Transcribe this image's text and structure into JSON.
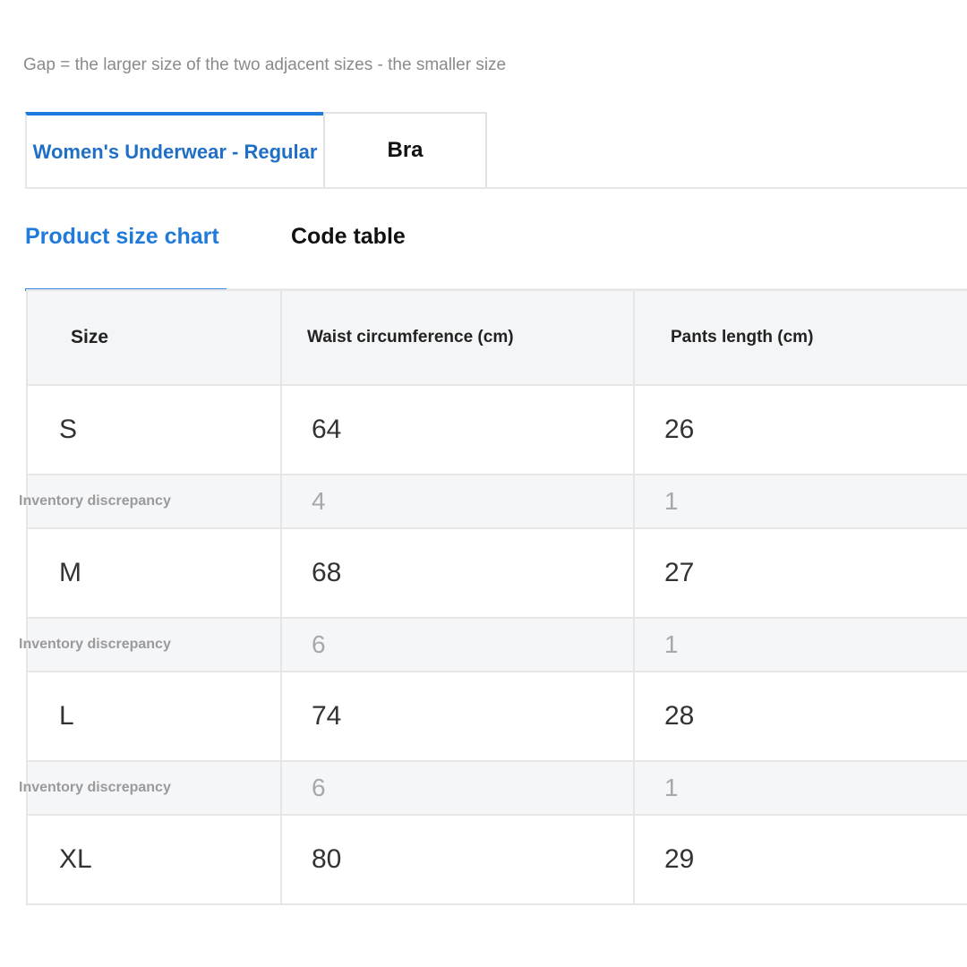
{
  "note": "Gap = the larger size of the two adjacent sizes - the smaller size",
  "category_tabs": [
    {
      "label": "Women's Underwear - Regular",
      "active": true
    },
    {
      "label": "Bra",
      "active": false
    }
  ],
  "sub_tabs": [
    {
      "label": "Product size chart",
      "active": true
    },
    {
      "label": "Code table",
      "active": false
    }
  ],
  "table": {
    "headers": [
      "Size",
      "Waist circumference (cm)",
      "Pants length (cm)"
    ],
    "rows": [
      {
        "type": "size",
        "cells": [
          "S",
          "64",
          "26"
        ]
      },
      {
        "type": "gap",
        "cells": [
          "Inventory discrepancy",
          "4",
          "1"
        ]
      },
      {
        "type": "size",
        "cells": [
          "M",
          "68",
          "27"
        ]
      },
      {
        "type": "gap",
        "cells": [
          "Inventory discrepancy",
          "6",
          "1"
        ]
      },
      {
        "type": "size",
        "cells": [
          "L",
          "74",
          "28"
        ]
      },
      {
        "type": "gap",
        "cells": [
          "Inventory discrepancy",
          "6",
          "1"
        ]
      },
      {
        "type": "size",
        "cells": [
          "XL",
          "80",
          "29"
        ]
      }
    ]
  },
  "colors": {
    "accent": "#1f7ad9",
    "header_bg": "#f4f5f7",
    "gap_row_bg": "#f5f6f8",
    "border": "#e6e6e6"
  }
}
